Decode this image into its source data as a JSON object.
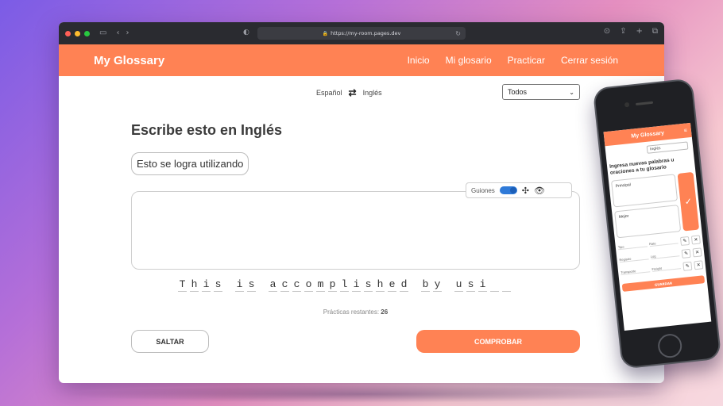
{
  "browser": {
    "url": "https://my-room.pages.dev"
  },
  "site": {
    "brand": "My Glossary",
    "nav": [
      "Inicio",
      "Mi glosario",
      "Practicar",
      "Cerrar sesión"
    ]
  },
  "practice": {
    "source_lang": "Español",
    "target_lang": "Inglés",
    "filter_value": "Todos",
    "heading": "Escribe esto en Inglés",
    "prompt": "Esto se logra utilizando",
    "toolbar": {
      "hyphens_label": "Guiones",
      "hyphens_on": true
    },
    "answer_chars": "This is accomplished by usi__",
    "remaining_label": "Prácticas restantes:",
    "remaining_count": "26",
    "skip_label": "SALTAR",
    "check_label": "COMPROBAR"
  },
  "phone": {
    "brand": "My Glossary",
    "select_value": "Inglés",
    "title": "Ingresa nuevas palabras u oraciones a tu glosario",
    "field1": "Principal",
    "field2": "Mejor",
    "rows": [
      {
        "a": "Tipo",
        "b": "Rate"
      },
      {
        "a": "Registro",
        "b": "Log"
      },
      {
        "a": "Transporte",
        "b": "Freight"
      }
    ],
    "save_label": "GUARDAR"
  },
  "icons": {
    "swap": "swap-arrows-icon",
    "puzzle": "puzzle-icon",
    "eye": "eye-icon",
    "check": "checkmark-icon",
    "edit": "pencil-icon",
    "delete": "x-icon"
  },
  "colors": {
    "brand": "#ff8254",
    "toggle": "#2f7ad8"
  }
}
